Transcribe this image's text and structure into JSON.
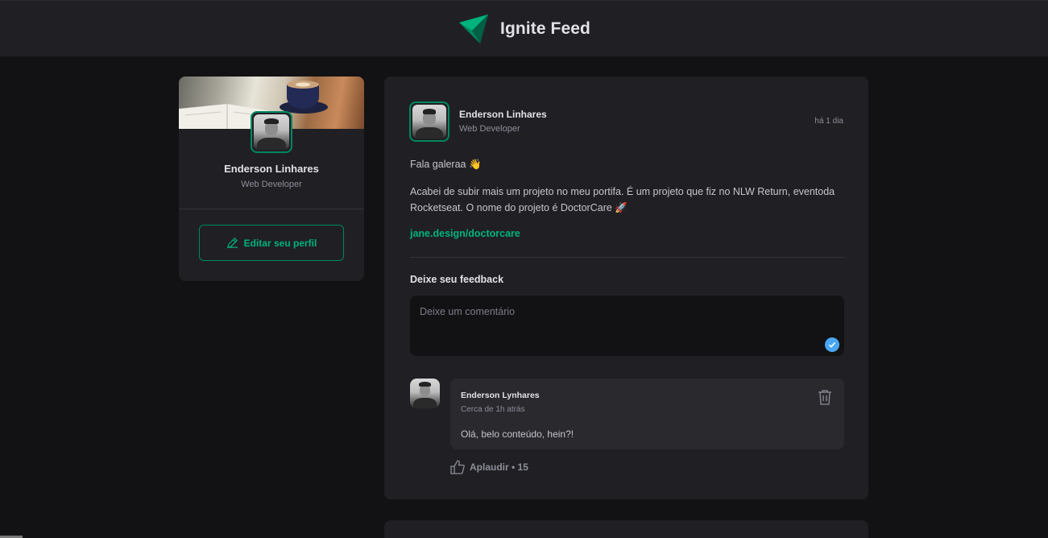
{
  "header": {
    "title": "Ignite Feed",
    "logo_icon": "ignite-logo-icon",
    "accent": "#00b37e"
  },
  "sidebar": {
    "name": "Enderson Linhares",
    "role": "Web Developer",
    "edit_button": "Editar seu perfil"
  },
  "post": {
    "author": "Enderson Linhares",
    "role": "Web Developer",
    "time": "há 1 dia",
    "paragraph1": "Fala galeraa 👋",
    "paragraph2": "Acabei de subir mais um projeto no meu portifa. É um projeto que fiz no NLW Return, eventoda Rocketseat. O nome do projeto é DoctorCare 🚀",
    "link": "jane.design/doctorcare",
    "feedback_title": "Deixe seu feedback",
    "feedback_placeholder": "Deixe um comentário"
  },
  "comment": {
    "author": "Enderson Lynhares",
    "time": "Cerca de 1h atrás",
    "text": "Olá, belo conteúdo, hein?!",
    "applaud": "Aplaudir • 15"
  }
}
